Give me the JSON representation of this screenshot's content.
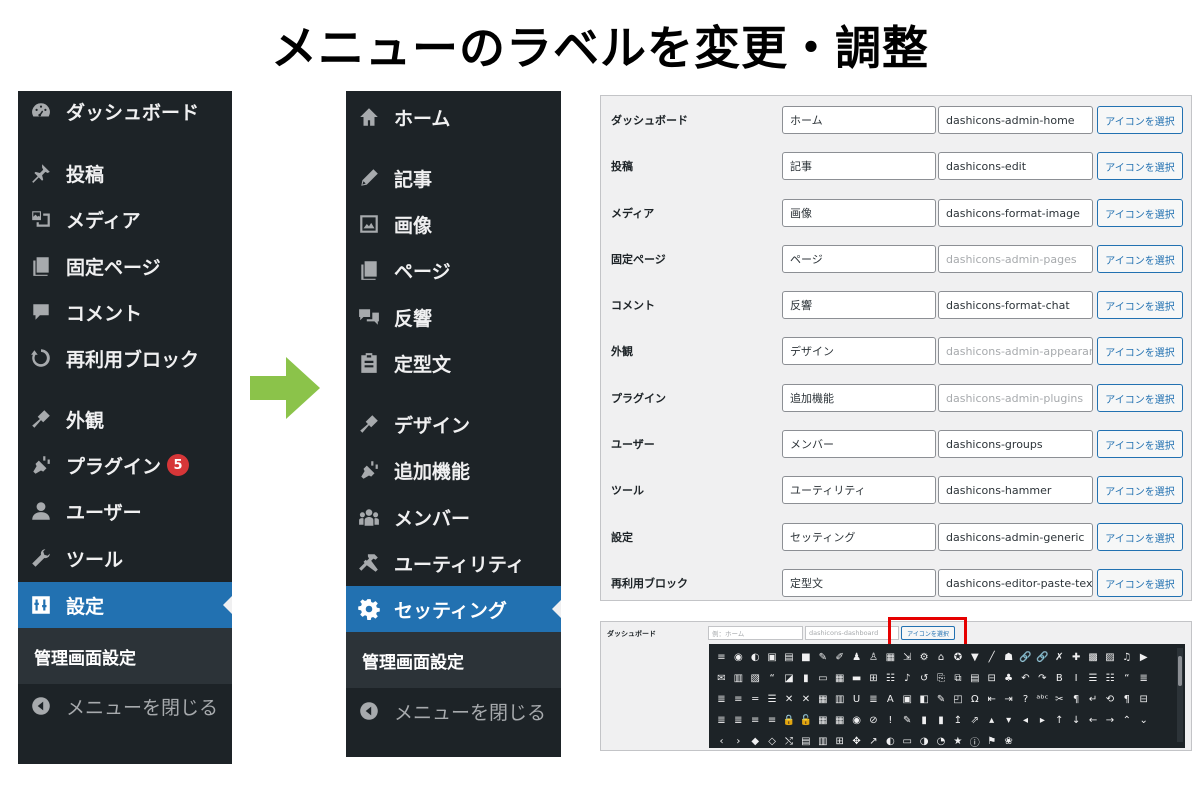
{
  "page_title": "メニューのラベルを変更・調整",
  "menu_before": {
    "items": [
      {
        "label": "ダッシュボード",
        "icon": "dashboard-icon"
      },
      {
        "label": "投稿",
        "icon": "pin-icon"
      },
      {
        "label": "メディア",
        "icon": "media-icon"
      },
      {
        "label": "固定ページ",
        "icon": "pages-icon"
      },
      {
        "label": "コメント",
        "icon": "comment-icon"
      },
      {
        "label": "再利用ブロック",
        "icon": "reusable-block-icon"
      },
      {
        "label": "外観",
        "icon": "appearance-icon"
      },
      {
        "label": "プラグイン",
        "icon": "plugin-icon",
        "badge": "5"
      },
      {
        "label": "ユーザー",
        "icon": "user-icon"
      },
      {
        "label": "ツール",
        "icon": "tools-icon"
      },
      {
        "label": "設定",
        "icon": "settings-icon",
        "active": true
      }
    ],
    "submenu_label": "管理画面設定",
    "collapse_label": "メニューを閉じる"
  },
  "menu_after": {
    "items": [
      {
        "label": "ホーム",
        "icon": "home-icon"
      },
      {
        "label": "記事",
        "icon": "edit-icon"
      },
      {
        "label": "画像",
        "icon": "image-icon"
      },
      {
        "label": "ページ",
        "icon": "pages-icon"
      },
      {
        "label": "反響",
        "icon": "chat-icon"
      },
      {
        "label": "定型文",
        "icon": "paste-text-icon"
      },
      {
        "label": "デザイン",
        "icon": "appearance-icon"
      },
      {
        "label": "追加機能",
        "icon": "plugin-icon"
      },
      {
        "label": "メンバー",
        "icon": "groups-icon"
      },
      {
        "label": "ユーティリティ",
        "icon": "hammer-icon"
      },
      {
        "label": "セッティング",
        "icon": "gear-icon",
        "active": true
      }
    ],
    "submenu_label": "管理画面設定",
    "collapse_label": "メニューを閉じる"
  },
  "settings": {
    "select_label": "アイコンを選択",
    "rows": [
      {
        "name": "ダッシュボード",
        "label": "ホーム",
        "icon_class": "dashicons-admin-home",
        "placeholder": false
      },
      {
        "name": "投稿",
        "label": "記事",
        "icon_class": "dashicons-edit",
        "placeholder": false
      },
      {
        "name": "メディア",
        "label": "画像",
        "icon_class": "dashicons-format-image",
        "placeholder": false
      },
      {
        "name": "固定ページ",
        "label": "ページ",
        "icon_class": "dashicons-admin-pages",
        "placeholder": true
      },
      {
        "name": "コメント",
        "label": "反響",
        "icon_class": "dashicons-format-chat",
        "placeholder": false
      },
      {
        "name": "外観",
        "label": "デザイン",
        "icon_class": "dashicons-admin-appearance",
        "placeholder": true
      },
      {
        "name": "プラグイン",
        "label": "追加機能",
        "icon_class": "dashicons-admin-plugins",
        "placeholder": true
      },
      {
        "name": "ユーザー",
        "label": "メンバー",
        "icon_class": "dashicons-groups",
        "placeholder": false
      },
      {
        "name": "ツール",
        "label": "ユーティリティ",
        "icon_class": "dashicons-hammer",
        "placeholder": false
      },
      {
        "name": "設定",
        "label": "セッティング",
        "icon_class": "dashicons-admin-generic",
        "placeholder": false
      },
      {
        "name": "再利用ブロック",
        "label": "定型文",
        "icon_class": "dashicons-editor-paste-text",
        "placeholder": false
      }
    ]
  },
  "picker": {
    "row_label": "ダッシュボード",
    "label_placeholder": "例：ホーム",
    "class_placeholder": "dashicons-dashboard",
    "button_label": "アイコンを選択",
    "highlight_color": "#e60000",
    "glyphs": [
      "≡",
      "◉",
      "◐",
      "▣",
      "▤",
      "■",
      "✎",
      "✐",
      "♟",
      "♙",
      "▦",
      "⇲",
      "⚙",
      "⌂",
      "✪",
      "▼",
      "╱",
      "☗",
      "🔗",
      "🔗",
      "✗",
      "✚",
      "▩",
      "▨",
      "♫",
      "▶",
      "✉",
      "▥",
      "▧",
      "“",
      "◪",
      "▮",
      "▭",
      "▦",
      "▬",
      "⊞",
      "☷",
      "♪",
      "↺",
      "⎘",
      "⧉",
      "▤",
      "⊟",
      "♣",
      "↶",
      "↷",
      "B",
      "I",
      "☰",
      "☷",
      "“",
      "≣",
      "≣",
      "≡",
      "═",
      "☰",
      "✕",
      "✕",
      "▦",
      "▥",
      "U",
      "≣",
      "A",
      "▣",
      "◧",
      "✎",
      "◰",
      "Ω",
      "⇤",
      "⇥",
      "?",
      "ᵃᵇᶜ",
      "✂",
      "¶",
      "↵",
      "⟲",
      "¶",
      "⊟",
      "≣",
      "≣",
      "≡",
      "≡",
      "🔒",
      "🔓",
      "▦",
      "▦",
      "◉",
      "⊘",
      "!",
      "✎",
      "▮",
      "▮",
      "↥",
      "⇗",
      "▴",
      "▾",
      "◂",
      "▸",
      "↑",
      "↓",
      "←",
      "→",
      "⌃",
      "⌄",
      "‹",
      "›",
      "◆",
      "◇",
      "⤭",
      "▤",
      "▥",
      "⊞",
      "✥",
      "↗",
      "◐",
      "▭",
      "◑",
      "◔",
      "★",
      "ⓘ",
      "⚑",
      "❀"
    ]
  },
  "colors": {
    "menu_bg": "#1d2327",
    "menu_active": "#2271b1",
    "submenu_bg": "#2c3338",
    "arrow": "#8bc34a",
    "badge": "#d63638"
  }
}
